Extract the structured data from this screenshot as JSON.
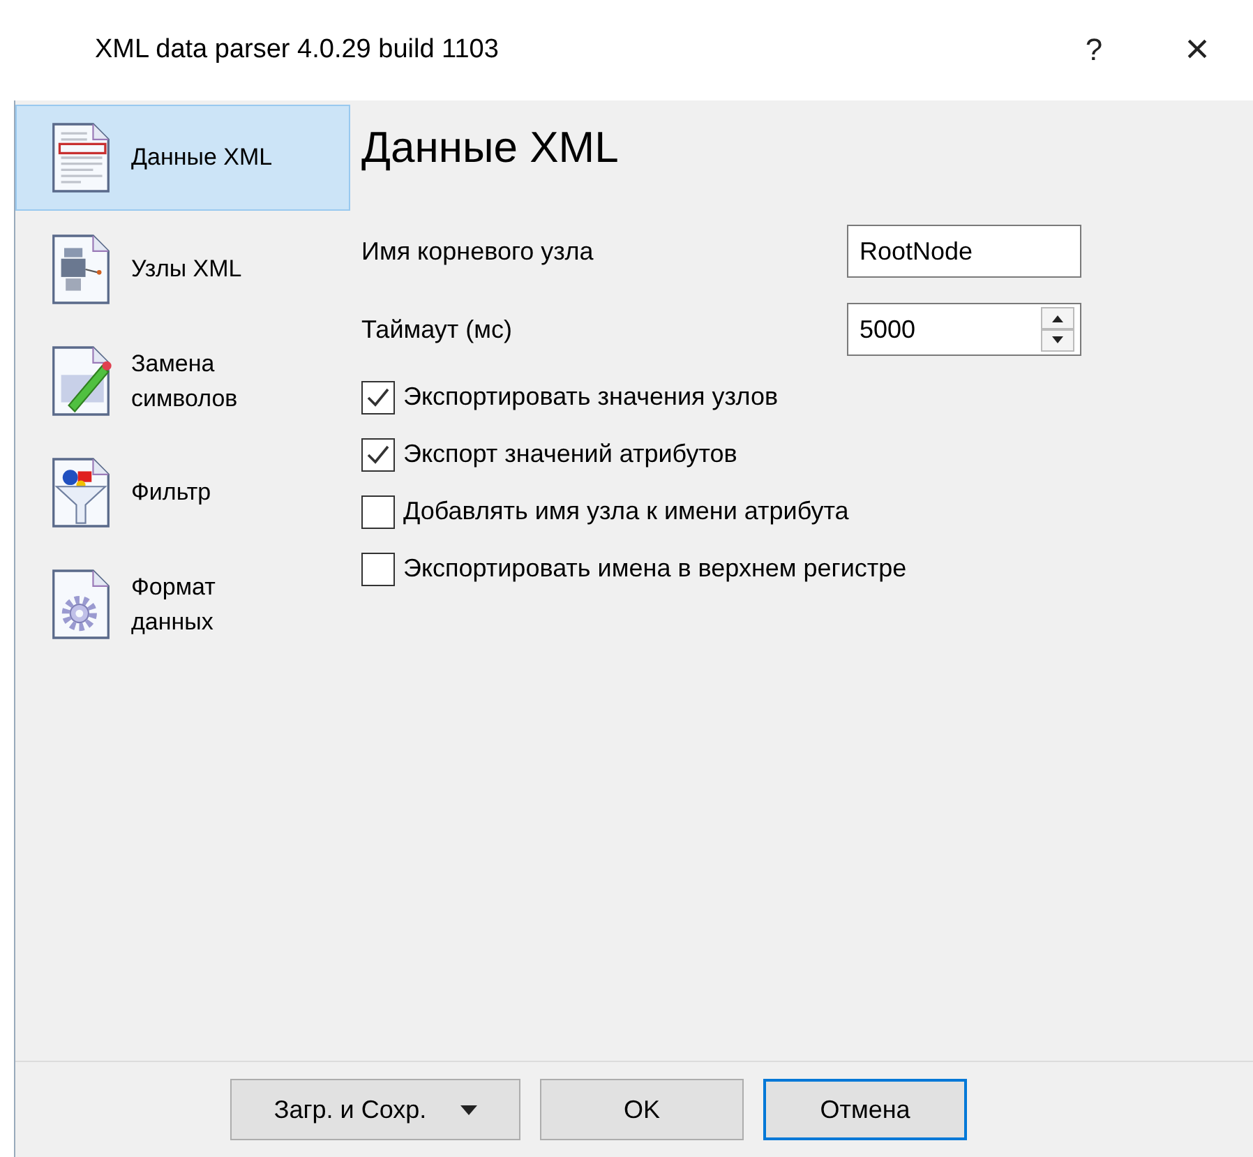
{
  "window": {
    "title": "XML data parser 4.0.29 build 1103",
    "help": "?",
    "close": "×"
  },
  "sidebar": {
    "items": [
      {
        "label": "Данные XML",
        "selected": true
      },
      {
        "label": "Узлы XML",
        "selected": false
      },
      {
        "label": "Замена символов",
        "selected": false
      },
      {
        "label": "Фильтр",
        "selected": false
      },
      {
        "label": "Формат данных",
        "selected": false
      }
    ]
  },
  "page": {
    "heading": "Данные XML",
    "fields": [
      {
        "kind": "text",
        "label": "Имя корневого узла",
        "value": "RootNode"
      },
      {
        "kind": "spin",
        "label": "Таймаут (мс)",
        "value": "5000"
      }
    ],
    "checkboxes": [
      {
        "label": "Экспортировать значения узлов",
        "checked": true
      },
      {
        "label": "Экспорт значений атрибутов",
        "checked": true
      },
      {
        "label": "Добавлять имя узла к имени атрибута",
        "checked": false
      },
      {
        "label": "Экспортировать имена в верхнем регистре",
        "checked": false
      }
    ]
  },
  "buttons": [
    {
      "label": "Загр. и Сохр.",
      "kind": "dropdown",
      "default": false
    },
    {
      "label": "OK",
      "kind": "plain",
      "default": false
    },
    {
      "label": "Отмена",
      "kind": "plain",
      "default": true
    }
  ]
}
